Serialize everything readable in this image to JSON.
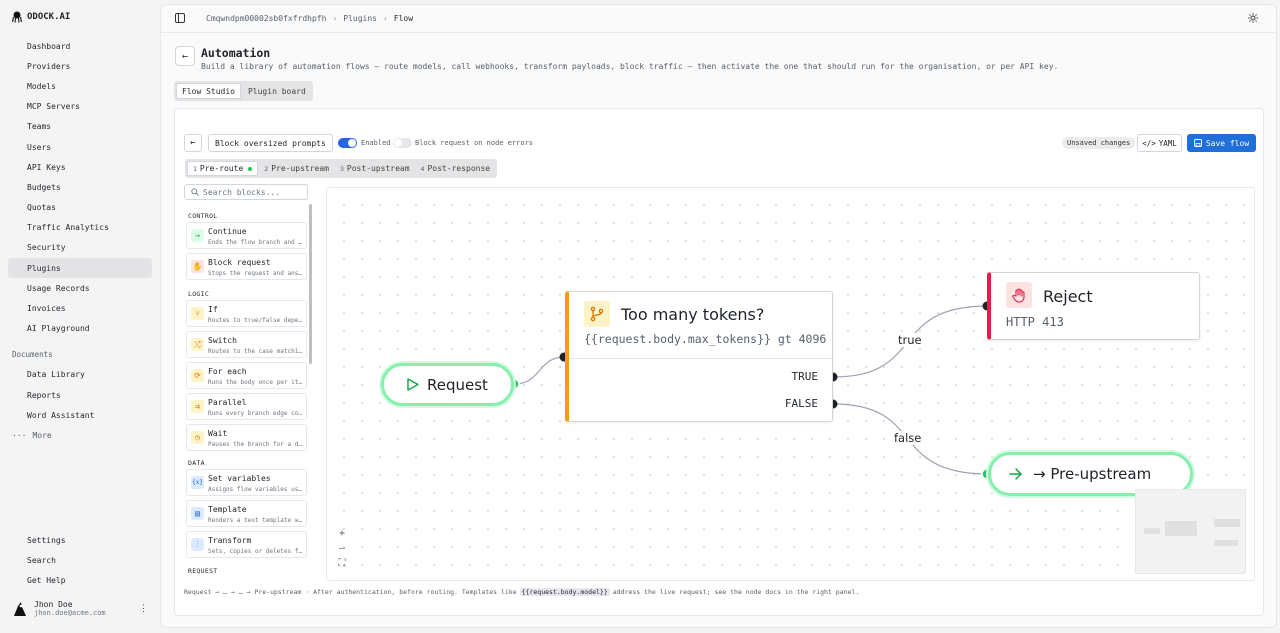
{
  "brand": {
    "name": "ODOCK.AI"
  },
  "nav": {
    "items": [
      {
        "label": "Dashboard",
        "icon": "dashboard-icon"
      },
      {
        "label": "Providers",
        "icon": "globe-icon"
      },
      {
        "label": "Models",
        "icon": "folder-icon"
      },
      {
        "label": "MCP Servers",
        "icon": "server-icon"
      },
      {
        "label": "Teams",
        "icon": "teams-icon"
      },
      {
        "label": "Users",
        "icon": "users-icon"
      },
      {
        "label": "API Keys",
        "icon": "key-icon"
      },
      {
        "label": "Budgets",
        "icon": "wallet-icon"
      },
      {
        "label": "Quotas",
        "icon": "gauge-icon"
      },
      {
        "label": "Traffic Analytics",
        "icon": "activity-icon"
      },
      {
        "label": "Security",
        "icon": "shield-icon"
      },
      {
        "label": "Plugins",
        "icon": "plug-icon",
        "active": true
      },
      {
        "label": "Usage Records",
        "icon": "records-icon"
      },
      {
        "label": "Invoices",
        "icon": "invoice-icon"
      },
      {
        "label": "AI Playground",
        "icon": "playground-icon"
      }
    ],
    "documents_heading": "Documents",
    "documents": [
      {
        "label": "Data Library",
        "icon": "database-icon"
      },
      {
        "label": "Reports",
        "icon": "report-icon"
      },
      {
        "label": "Word Assistant",
        "icon": "doc-icon"
      }
    ],
    "more_label": "More",
    "bottom": [
      {
        "label": "Settings",
        "icon": "settings-icon"
      },
      {
        "label": "Search",
        "icon": "search-icon"
      },
      {
        "label": "Get Help",
        "icon": "help-icon"
      }
    ]
  },
  "user": {
    "name": "Jhon Doe",
    "email": "jhon.doe@acme.com"
  },
  "breadcrumb": [
    "Cmqwndpm00002sb0fxfrdhpfh",
    "Plugins",
    "Flow"
  ],
  "page": {
    "title": "Automation",
    "subtitle": "Build a library of automation flows — route models, call webhooks, transform payloads, block traffic — then activate the one that should run for the organisation, or per API key."
  },
  "view_tabs": [
    {
      "label": "Flow Studio",
      "active": true
    },
    {
      "label": "Plugin board",
      "active": false
    }
  ],
  "flow": {
    "name": "Block oversized prompts",
    "enabled_label": "Enabled",
    "enabled": true,
    "block_on_error_label": "Block request on node errors",
    "block_on_error": false,
    "unsaved_label": "Unsaved changes",
    "yaml_label": "YAML",
    "save_label": "Save flow"
  },
  "stages": [
    {
      "num": "1",
      "label": "Pre-route",
      "active": true
    },
    {
      "num": "2",
      "label": "Pre-upstream",
      "active": false
    },
    {
      "num": "3",
      "label": "Post-upstream",
      "active": false
    },
    {
      "num": "4",
      "label": "Post-response",
      "active": false
    }
  ],
  "palette": {
    "search_placeholder": "Search blocks...",
    "control_heading": "CONTROL",
    "control": [
      {
        "title": "Continue",
        "desc": "Ends the flow branch and continues",
        "icon": "arrow-right-icon",
        "color": "#16a34a",
        "bg": "#dcfce7"
      },
      {
        "title": "Block request",
        "desc": "Stops the request and answers",
        "icon": "hand-icon",
        "color": "#e11d48",
        "bg": "#fee2e2"
      }
    ],
    "logic_heading": "LOGIC",
    "logic": [
      {
        "title": "If",
        "desc": "Routes to true/false depending",
        "icon": "branch-icon",
        "color": "#d97706",
        "bg": "#fef3c7"
      },
      {
        "title": "Switch",
        "desc": "Routes to the case matching",
        "icon": "shuffle-icon",
        "color": "#d97706",
        "bg": "#fef3c7"
      },
      {
        "title": "For each",
        "desc": "Runs the body once per item",
        "icon": "repeat-icon",
        "color": "#d97706",
        "bg": "#fef3c7"
      },
      {
        "title": "Parallel",
        "desc": "Runs every branch edge concurrently",
        "icon": "parallel-icon",
        "color": "#d97706",
        "bg": "#fef3c7"
      },
      {
        "title": "Wait",
        "desc": "Pauses the branch for a duration",
        "icon": "clock-icon",
        "color": "#d97706",
        "bg": "#fef3c7"
      }
    ],
    "data_heading": "DATA",
    "data": [
      {
        "title": "Set variables",
        "desc": "Assigns flow variables used",
        "icon": "variable-icon",
        "color": "#2563eb",
        "bg": "#dbeafe"
      },
      {
        "title": "Template",
        "desc": "Renders a text template with",
        "icon": "template-icon",
        "color": "#2563eb",
        "bg": "#dbeafe"
      },
      {
        "title": "Transform",
        "desc": "Sets, copies or deletes fields",
        "icon": "sliders-icon",
        "color": "#2563eb",
        "bg": "#dbeafe"
      }
    ],
    "request_heading": "REQUEST"
  },
  "canvas": {
    "request_node": "Request",
    "condition_node": {
      "title": "Too many tokens?",
      "expr": "{{request.body.max_tokens}} gt 4096",
      "true_label": "TRUE",
      "false_label": "FALSE"
    },
    "reject_node": {
      "title": "Reject",
      "subtitle": "HTTP 413"
    },
    "pre_upstream_node": "→ Pre-upstream",
    "edge_true": "true",
    "edge_false": "false"
  },
  "hint": {
    "prefix": "Request → … → … → Pre-upstream · After authentication, before routing. Templates like",
    "code": "{{request.body.model}}",
    "suffix": "address the live request; see the node docs in the right panel."
  },
  "colors": {
    "accent": "#1e6fd9",
    "entry": "#86efac",
    "logic": "#f59e0b",
    "reject": "#e11d48"
  }
}
